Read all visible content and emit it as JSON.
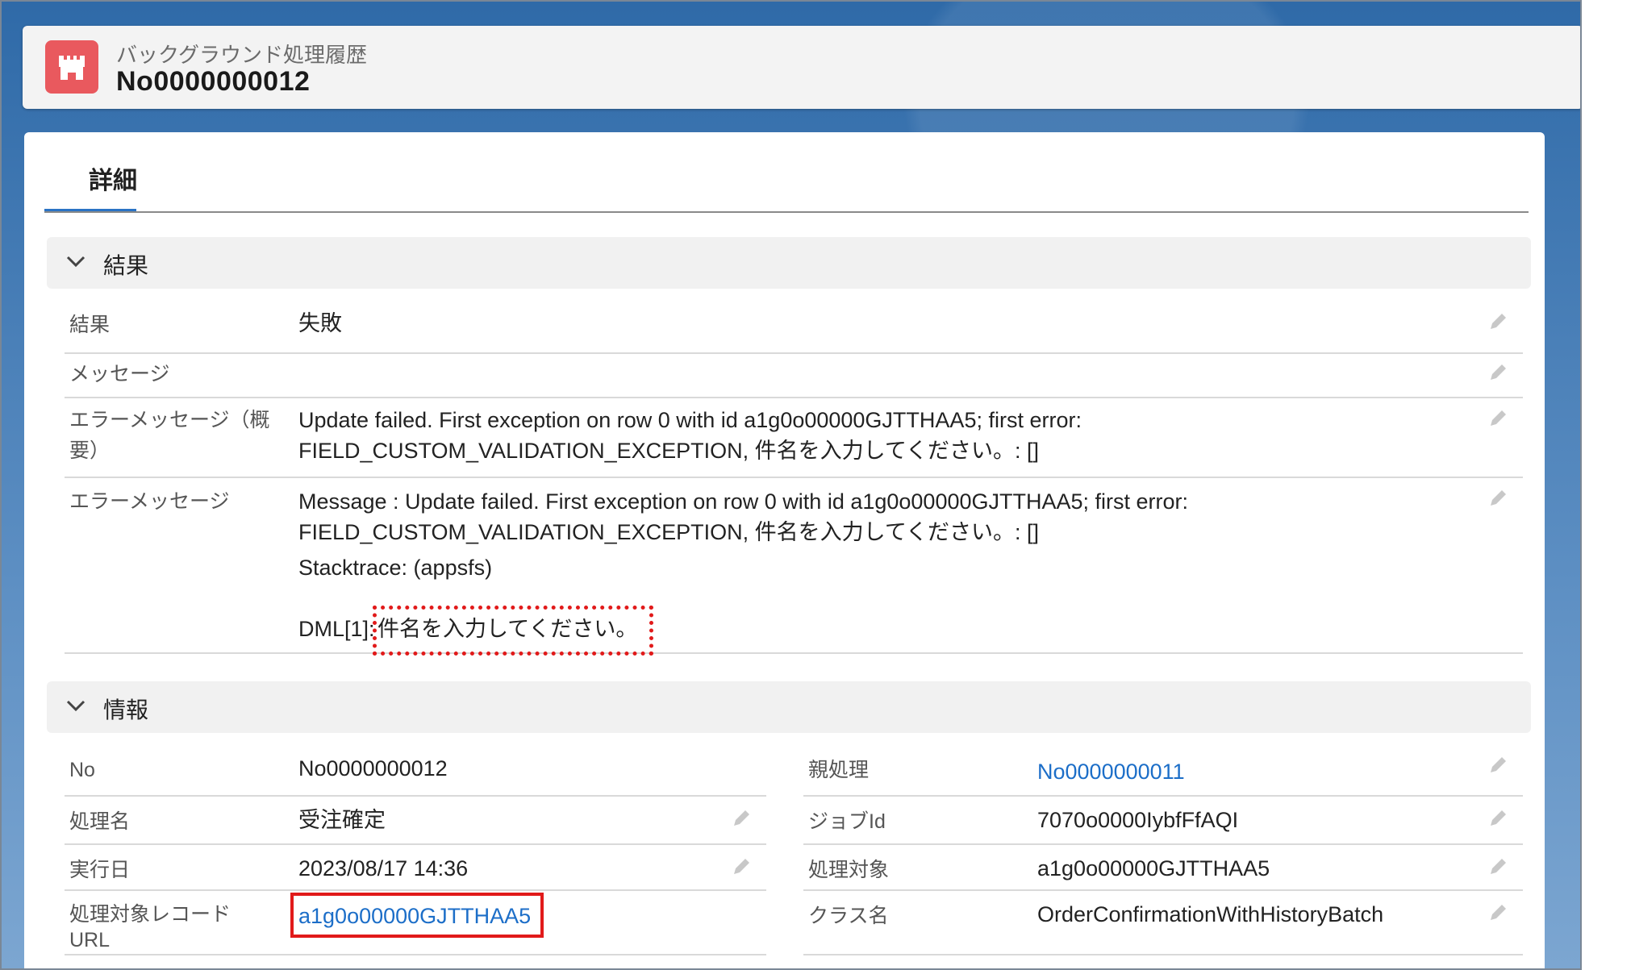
{
  "header": {
    "object_label": "バックグラウンド処理履歴",
    "record_title": "No0000000012",
    "icon": "castle-icon"
  },
  "tabs": [
    {
      "label": "詳細"
    }
  ],
  "sections": {
    "result": {
      "title": "結果",
      "fields": {
        "result": {
          "label": "結果",
          "value": "失敗"
        },
        "message": {
          "label": "メッセージ",
          "value": ""
        },
        "error_summary": {
          "label_line1": "エラーメッセージ（概",
          "label_line2": "要）",
          "value_line1": "Update failed. First exception on row 0 with id a1g0o00000GJTTHAA5; first error:",
          "value_line2": "FIELD_CUSTOM_VALIDATION_EXCEPTION, 件名を入力してください。: []"
        },
        "error_message": {
          "label": "エラーメッセージ",
          "value_line1": "Message : Update failed. First exception on row 0 with id a1g0o00000GJTTHAA5; first error:",
          "value_line2": "FIELD_CUSTOM_VALIDATION_EXCEPTION, 件名を入力してください。: []",
          "value_line3": "Stacktrace: (appsfs)",
          "value_line4_prefix": "DML[1]:",
          "value_line4_highlight": "件名を入力してください。"
        }
      }
    },
    "info": {
      "title": "情報",
      "left": {
        "no": {
          "label": "No",
          "value": "No0000000012"
        },
        "process_name": {
          "label": "処理名",
          "value": "受注確定"
        },
        "exec_date": {
          "label": "実行日",
          "value": "2023/08/17 14:36"
        },
        "target_record_url": {
          "label_line1": "処理対象レコード",
          "label_line2": "URL",
          "value": "a1g0o00000GJTTHAA5"
        }
      },
      "right": {
        "parent_process": {
          "label": "親処理",
          "value": "No0000000011"
        },
        "job_id": {
          "label": "ジョブId",
          "value": "7070o0000IybfFfAQI"
        },
        "target": {
          "label": "処理対象",
          "value": "a1g0o00000GJTTHAA5"
        },
        "class_name": {
          "label": "クラス名",
          "value": "OrderConfirmationWithHistoryBatch"
        }
      }
    }
  },
  "colors": {
    "accent": "#2a73c5",
    "link": "#1c6ec8",
    "icon_bg": "#e9595e",
    "highlight": "#e11a1a"
  }
}
